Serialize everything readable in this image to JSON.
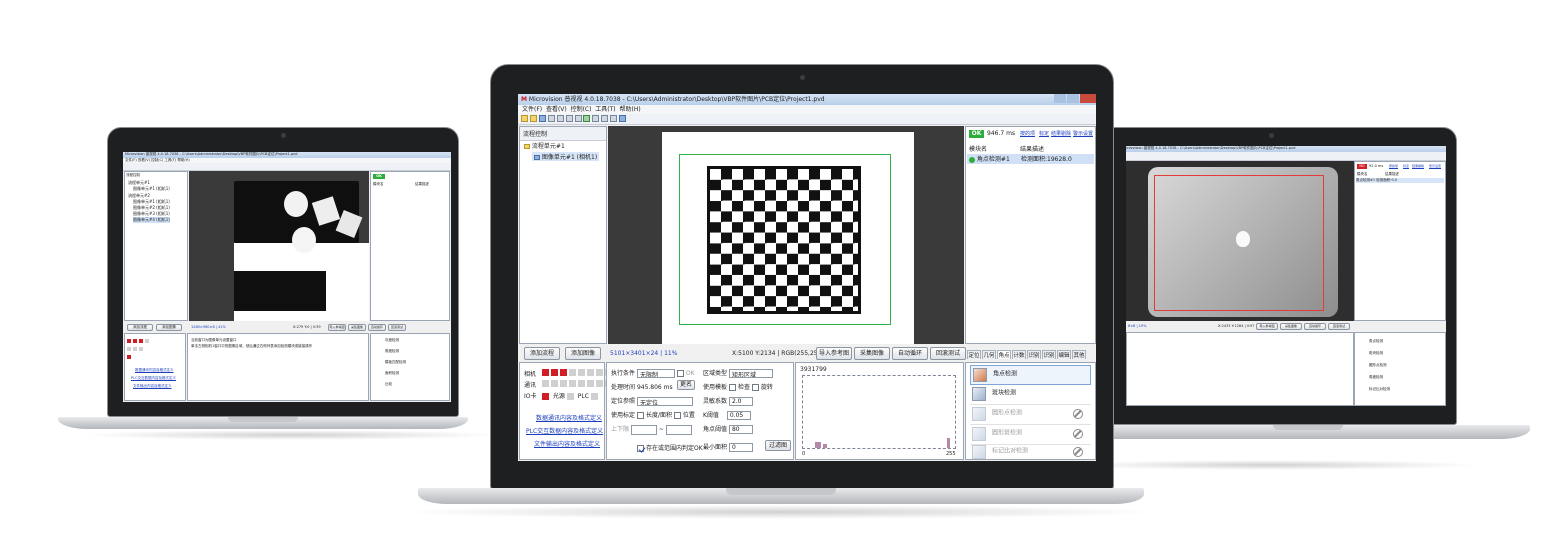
{
  "colors": {
    "ok_green": "#2cae3c",
    "indicator_red": "#d11e24",
    "link_blue": "#1b3fbf",
    "roi_green": "#2fb24a"
  },
  "center": {
    "title": "Microvision 普视视 4.0.18.7038 - C:\\Users\\Administrator\\Desktop\\VBP软件图片\\PCB定位\\Project1.pvd",
    "menus": [
      "文件(F)",
      "查看(V)",
      "控制(C)",
      "工具(T)",
      "帮助(H)"
    ],
    "flow_panel_title": "流程控制",
    "tree": {
      "root": "流程单元#1",
      "child": "图像单元#1 (相机1)"
    },
    "buttons": {
      "add_flow": "添加流程",
      "add_image": "添加图像",
      "load_ref": "导入参考图",
      "capture": "采集图像",
      "auto_capture": "自动循环",
      "loop_test": "回滚测试"
    },
    "status": {
      "size": "5101×3401×24 | 11%",
      "coords": "X:5100 Y:2134 | RGB(255,255,255)"
    },
    "indicators": [
      {
        "label": "相机",
        "on": 3,
        "total": 8
      },
      {
        "label": "通讯",
        "on": 0,
        "total": 8
      },
      {
        "label": "IO卡",
        "on": 1,
        "total": 1
      }
    ],
    "io_labels": {
      "light": "光源",
      "plc": "PLC"
    },
    "links": [
      "数据通讯内容及格式定义",
      "PLC交互数据内容及格式定义",
      "文件输出内容及格式定义"
    ],
    "params": {
      "exec_cond_label": "执行条件",
      "exec_cond_value": "无限制",
      "ok_label": "OK",
      "time_label": "处理时间",
      "time_value": "945.806 ms",
      "rename": "更名",
      "ref_label": "定位参照",
      "ref_value": "无定位",
      "calib_label": "使用标定",
      "length_area": "长度/面积",
      "position": "位置",
      "range_label": "上下限",
      "exist_ok": "存在或范围内判定OK",
      "region_label": "区域类型",
      "region_value": "矩形区域",
      "target_label": "使用模板",
      "check": "检查",
      "rotate": "旋转",
      "sensitivity_label": "灵敏系数",
      "sensitivity_value": "2.0",
      "k_label": "K阈值",
      "k_value": "0.05",
      "corner_label": "角点阈值",
      "corner_value": "80",
      "min_area_label": "最小面积",
      "min_area_value": "0",
      "filter_btn": "过滤图"
    },
    "histogram": {
      "count": "3931799",
      "min_label": "0",
      "max_label": "255"
    },
    "results": {
      "ok": "OK",
      "time": "946.7 ms",
      "links": [
        "按的项",
        "标定",
        "结果剔除",
        "警示设置"
      ],
      "col_name": "模块名",
      "col_result": "结果描述",
      "item_name": "角点检测#1",
      "item_result": "检测面积:19628.0"
    },
    "tool_tabs": [
      "定位",
      "几何",
      "角点",
      "计数",
      "识别",
      "识别",
      "编辑",
      "其他"
    ],
    "tools": [
      "角点检测",
      "斑块检测",
      "圆形点检测",
      "圆形斑检测",
      "标记比对检测"
    ]
  },
  "left": {
    "title": "Microvision 普视视 4.0.18.7038 - C:\\Users\\Administrator\\Desktop\\VBP软件图片\\PCB定位\\Project1.pvd",
    "flow_panel_title": "流程控制",
    "tree": [
      "流程单元#1",
      "图像单元#1 (相机1)",
      "流程单元#2",
      "图像单元#1 (相机1)",
      "图像单元#2 (相机1)",
      "图像单元#3 (相机1)",
      "图像单元#4 (相机1)"
    ],
    "buttons": {
      "add_flow": "添加流程",
      "add_image": "添加图像"
    },
    "status": "1280×960×8 | 41%",
    "coords": "X:279 Y:0 | V:39",
    "btns": [
      "导入参考图",
      "采集图像",
      "自动循环",
      "回滚测试"
    ],
    "ok": "OK",
    "col_name": "模块名",
    "col_result": "结果描述",
    "info_lines": [
      "当前窗口为图像单元设置窗口",
      "单击左侧相机1窗口中的图像区域，然后通过右侧列表添加检测模块或链接操作"
    ],
    "links": [
      "数据通讯内容及格式定义",
      "PLC交互数据内容及格式定义",
      "文件输出内容及格式定义"
    ],
    "tools": [
      "灰度检测",
      "角度检测",
      "模板匹配检测",
      "面积检测",
      "比较"
    ]
  },
  "right": {
    "title": "icrovision 普视视 4.0.18.7038 - C:\\Users\\Administrator\\Desktop\\VBP软件图片\\PCB定位\\Project1.pvd",
    "ok": "NG",
    "time": "92.0 ms",
    "links": [
      "按的项",
      "标定",
      "结果剔除",
      "警示设置"
    ],
    "col_name": "模块名",
    "col_result": "结果描述",
    "item_name": "角点检测#1",
    "item_result": "检测面积:0.0",
    "status": "8×8 | 19%",
    "coords": "X:2433 Y:1284 | V:97",
    "btns": [
      "导入参考图",
      "采集图像",
      "自动循环",
      "回滚测试"
    ],
    "tools": [
      "角点检测",
      "斑块检测",
      "圆形点检测",
      "角度检测",
      "标记比对检测"
    ]
  }
}
